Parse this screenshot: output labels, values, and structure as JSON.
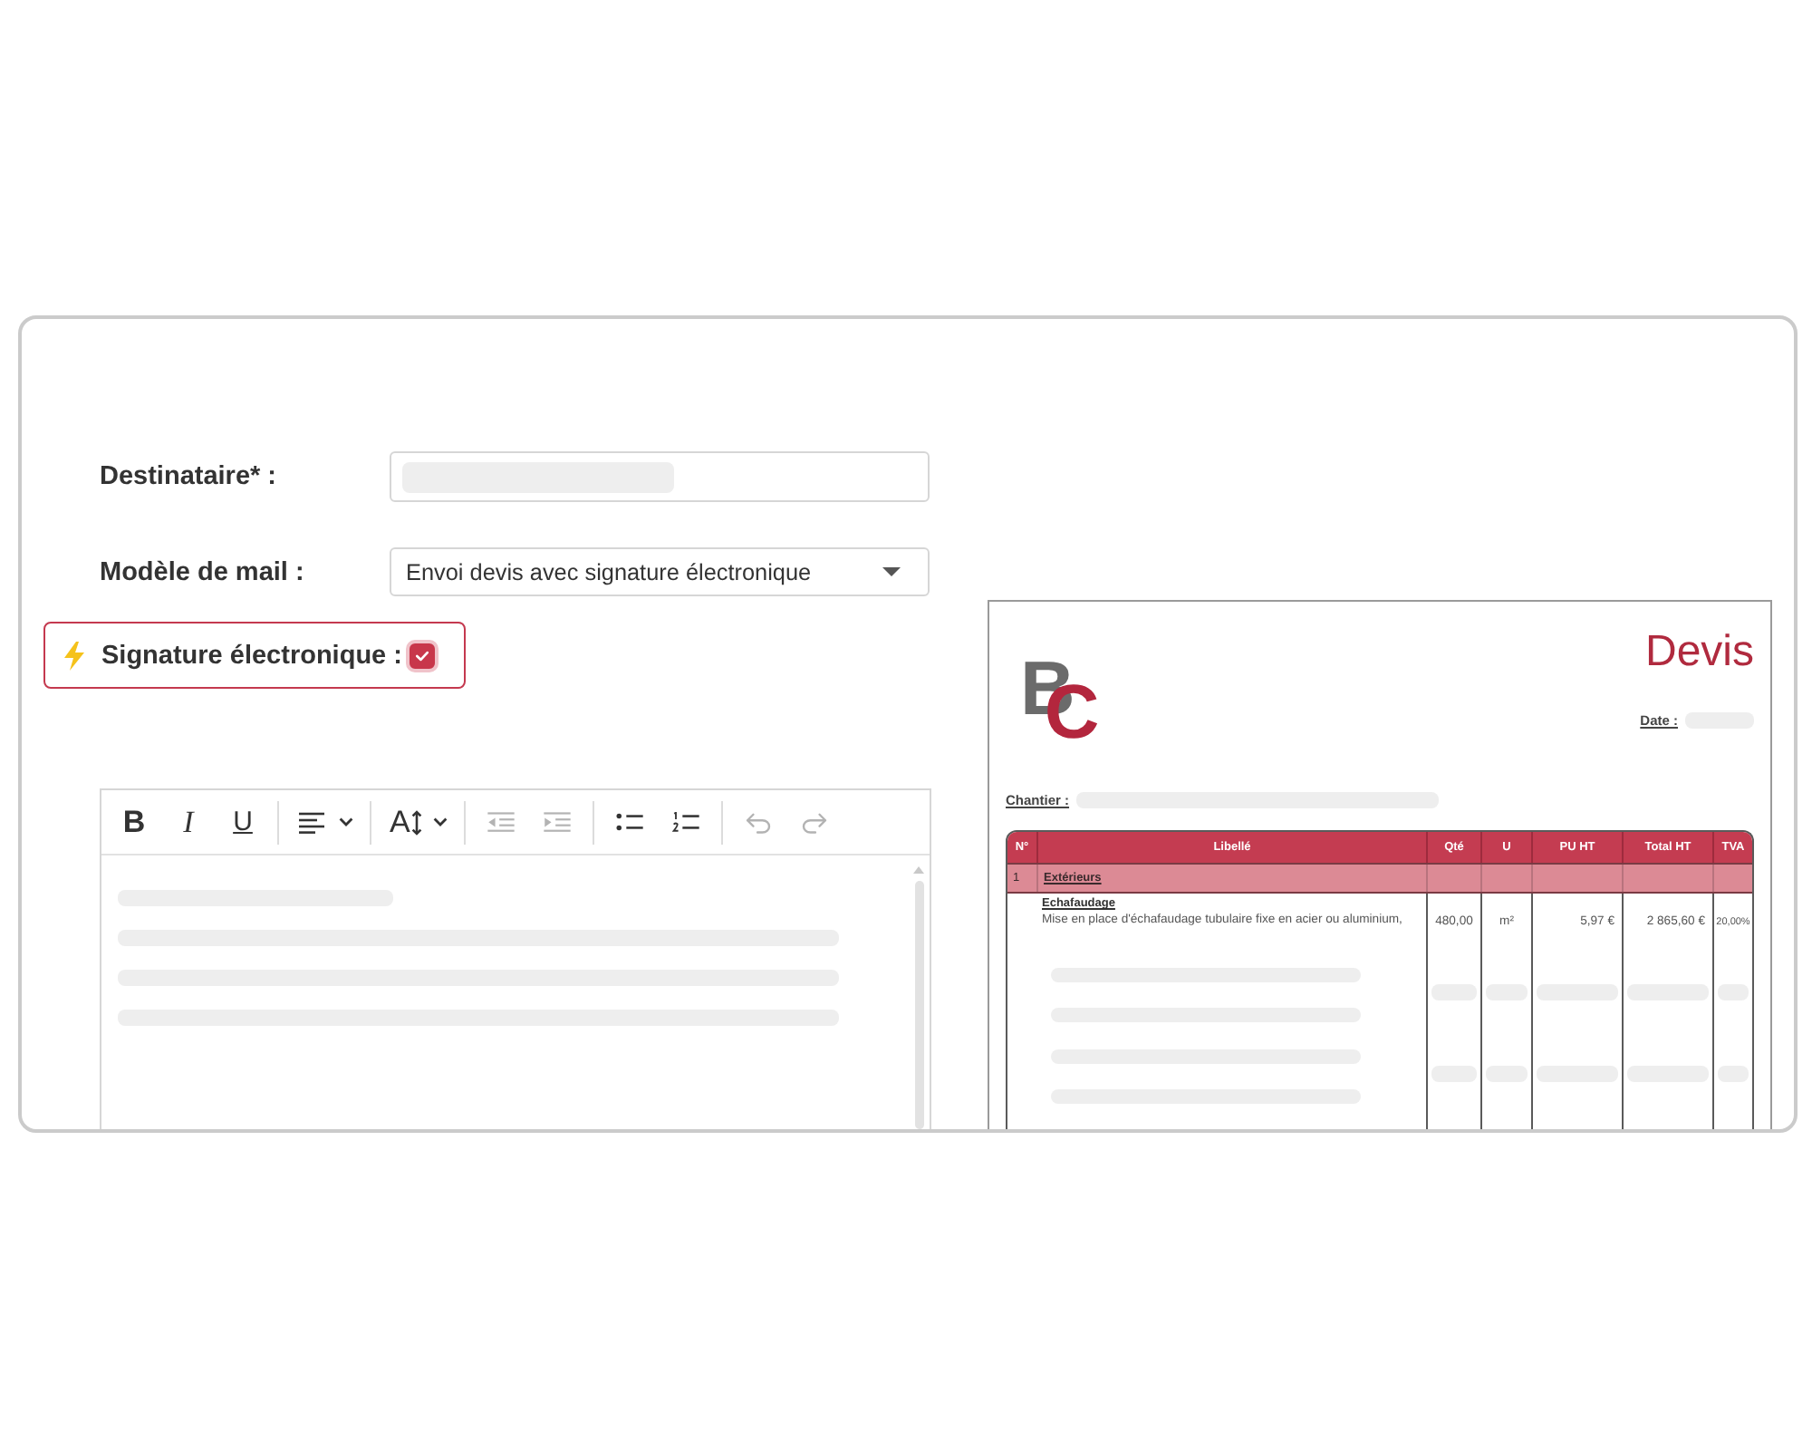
{
  "form": {
    "fields": [
      {
        "kind": "text",
        "label": "Destinataire* :",
        "redacted": true
      },
      {
        "kind": "select",
        "label": "Modèle de mail :",
        "value": "Envoi devis avec signature électronique"
      }
    ],
    "e_signature": {
      "label": "Signature électronique :",
      "checked": true
    }
  },
  "editor": {
    "toolbar": [
      {
        "items": [
          {
            "kind": "bold",
            "label": "B",
            "disabled": false
          },
          {
            "kind": "italic",
            "label": "I",
            "disabled": false
          },
          {
            "kind": "underline",
            "label": "U",
            "disabled": false
          }
        ]
      },
      {
        "items": [
          {
            "kind": "align",
            "disabled": false
          }
        ]
      },
      {
        "items": [
          {
            "kind": "font_size",
            "label": "A",
            "disabled": false
          }
        ]
      },
      {
        "items": [
          {
            "kind": "outdent",
            "disabled": true
          },
          {
            "kind": "indent",
            "disabled": true
          }
        ]
      },
      {
        "items": [
          {
            "kind": "bullet_list",
            "disabled": false
          },
          {
            "kind": "numbered_list",
            "disabled": false
          }
        ]
      },
      {
        "items": [
          {
            "kind": "undo",
            "disabled": true
          },
          {
            "kind": "redo",
            "disabled": true
          }
        ]
      }
    ],
    "body_redacted": true
  },
  "preview": {
    "logo": [
      "B",
      "C"
    ],
    "title": "Devis",
    "date_label": "Date :",
    "date_redacted": true,
    "site_label": "Chantier :",
    "site_redacted": true,
    "table": {
      "columns": [
        "N°",
        "Libellé",
        "Qté",
        "U",
        "PU HT",
        "Total HT",
        "TVA"
      ],
      "rows": [
        {
          "kind": "section",
          "number": "1",
          "label": "Extérieurs"
        },
        {
          "kind": "item",
          "title": "Echafaudage",
          "description": "Mise en place d'échafaudage tubulaire fixe en acier ou aluminium,",
          "quantity": "480,00",
          "unit": "m²",
          "unit_price": "5,97 €",
          "total": "2 865,60 €",
          "vat": "20,00%"
        },
        {
          "kind": "redacted"
        },
        {
          "kind": "redacted"
        }
      ]
    }
  }
}
